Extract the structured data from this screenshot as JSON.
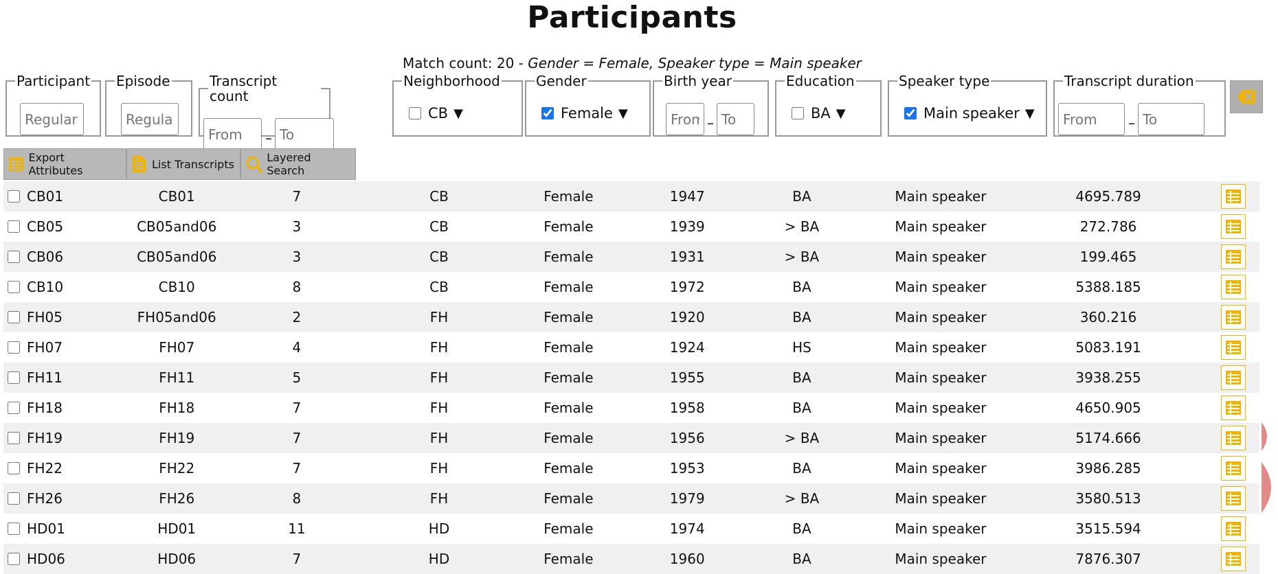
{
  "page": {
    "title": "Participants"
  },
  "match": {
    "label": "Match count: 20 - ",
    "criteria": "Gender = Female, Speaker type = Main speaker"
  },
  "filters": {
    "participant": {
      "legend": "Participant",
      "placeholder": "Regular Expression"
    },
    "episode": {
      "legend": "Episode",
      "placeholder": "Regular Expression"
    },
    "transcript_count": {
      "legend": "Transcript count",
      "from_placeholder": "From",
      "to_placeholder": "To"
    },
    "neighborhood": {
      "legend": "Neighborhood",
      "value": "CB",
      "checked": false
    },
    "gender": {
      "legend": "Gender",
      "value": "Female",
      "checked": true
    },
    "birth_year": {
      "legend": "Birth year",
      "from_placeholder": "From",
      "to_placeholder": "To"
    },
    "education": {
      "legend": "Education",
      "value": "BA",
      "checked": false
    },
    "speaker_type": {
      "legend": "Speaker type",
      "value": "Main speaker",
      "checked": true
    },
    "transcript_duration": {
      "legend": "Transcript duration",
      "from_placeholder": "From",
      "to_placeholder": "To"
    },
    "dropdown_arrow": "▼",
    "range_separator": "–"
  },
  "toolbar": {
    "export_attributes": "Export Attributes",
    "list_transcripts": "List Transcripts",
    "layered_search": "Layered Search"
  },
  "colors": {
    "accent_icon": "#f0b400",
    "button_bg": "#b8b8b8",
    "stripe": "#f0f0f0",
    "pink": "#e08a8a"
  },
  "rows": [
    {
      "id": "CB01",
      "episode": "CB01",
      "count": "7",
      "neighborhood": "CB",
      "gender": "Female",
      "birth_year": "1947",
      "education": "BA",
      "speaker_type": "Main speaker",
      "duration": "4695.789"
    },
    {
      "id": "CB05",
      "episode": "CB05and06",
      "count": "3",
      "neighborhood": "CB",
      "gender": "Female",
      "birth_year": "1939",
      "education": "> BA",
      "speaker_type": "Main speaker",
      "duration": "272.786"
    },
    {
      "id": "CB06",
      "episode": "CB05and06",
      "count": "3",
      "neighborhood": "CB",
      "gender": "Female",
      "birth_year": "1931",
      "education": "> BA",
      "speaker_type": "Main speaker",
      "duration": "199.465"
    },
    {
      "id": "CB10",
      "episode": "CB10",
      "count": "8",
      "neighborhood": "CB",
      "gender": "Female",
      "birth_year": "1972",
      "education": "BA",
      "speaker_type": "Main speaker",
      "duration": "5388.185"
    },
    {
      "id": "FH05",
      "episode": "FH05and06",
      "count": "2",
      "neighborhood": "FH",
      "gender": "Female",
      "birth_year": "1920",
      "education": "BA",
      "speaker_type": "Main speaker",
      "duration": "360.216"
    },
    {
      "id": "FH07",
      "episode": "FH07",
      "count": "4",
      "neighborhood": "FH",
      "gender": "Female",
      "birth_year": "1924",
      "education": "HS",
      "speaker_type": "Main speaker",
      "duration": "5083.191"
    },
    {
      "id": "FH11",
      "episode": "FH11",
      "count": "5",
      "neighborhood": "FH",
      "gender": "Female",
      "birth_year": "1955",
      "education": "BA",
      "speaker_type": "Main speaker",
      "duration": "3938.255"
    },
    {
      "id": "FH18",
      "episode": "FH18",
      "count": "7",
      "neighborhood": "FH",
      "gender": "Female",
      "birth_year": "1958",
      "education": "BA",
      "speaker_type": "Main speaker",
      "duration": "4650.905"
    },
    {
      "id": "FH19",
      "episode": "FH19",
      "count": "7",
      "neighborhood": "FH",
      "gender": "Female",
      "birth_year": "1956",
      "education": "> BA",
      "speaker_type": "Main speaker",
      "duration": "5174.666"
    },
    {
      "id": "FH22",
      "episode": "FH22",
      "count": "7",
      "neighborhood": "FH",
      "gender": "Female",
      "birth_year": "1953",
      "education": "BA",
      "speaker_type": "Main speaker",
      "duration": "3986.285"
    },
    {
      "id": "FH26",
      "episode": "FH26",
      "count": "8",
      "neighborhood": "FH",
      "gender": "Female",
      "birth_year": "1979",
      "education": "> BA",
      "speaker_type": "Main speaker",
      "duration": "3580.513"
    },
    {
      "id": "HD01",
      "episode": "HD01",
      "count": "11",
      "neighborhood": "HD",
      "gender": "Female",
      "birth_year": "1974",
      "education": "BA",
      "speaker_type": "Main speaker",
      "duration": "3515.594"
    },
    {
      "id": "HD06",
      "episode": "HD06",
      "count": "7",
      "neighborhood": "HD",
      "gender": "Female",
      "birth_year": "1960",
      "education": "BA",
      "speaker_type": "Main speaker",
      "duration": "7876.307"
    }
  ]
}
